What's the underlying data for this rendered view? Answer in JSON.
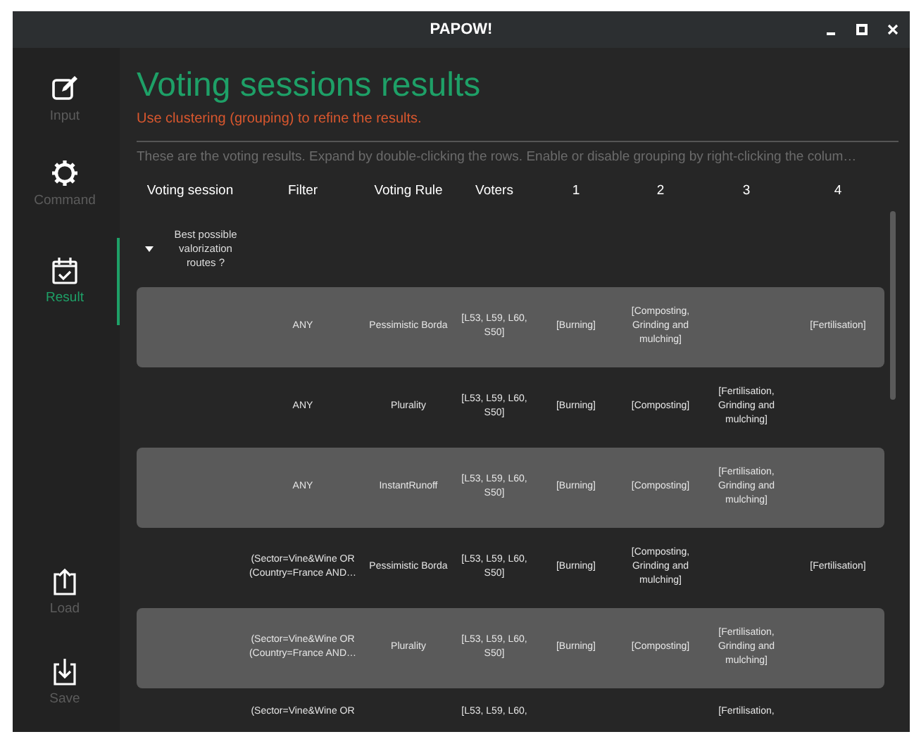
{
  "window": {
    "title": "PAPOW!"
  },
  "sidebar": {
    "items": [
      {
        "label": "Input",
        "kind": "edit",
        "selected": false
      },
      {
        "label": "Command",
        "kind": "gear",
        "selected": false
      },
      {
        "label": "Result",
        "kind": "calendar",
        "selected": true
      }
    ],
    "bottom_items": [
      {
        "label": "Load",
        "kind": "upload"
      },
      {
        "label": "Save",
        "kind": "download"
      }
    ]
  },
  "heading": "Voting sessions results",
  "subtitle": "Use clustering (grouping) to refine the results.",
  "description": "These are the voting results. Expand by double-clicking the rows. Enable or disable grouping by right-clicking the colum…",
  "table": {
    "columns": [
      "Voting session",
      "Filter",
      "Voting Rule",
      "Voters",
      "1",
      "2",
      "3",
      "4"
    ],
    "group": {
      "label": "Best possible valorization routes ?",
      "expanded": true
    },
    "rows": [
      {
        "shaded": true,
        "cells": [
          "",
          "ANY",
          "Pessimistic Borda",
          "[L53, L59, L60, S50]",
          "[Burning]",
          "[Composting, Grinding and mulching]",
          "",
          "[Fertilisation]"
        ]
      },
      {
        "shaded": false,
        "cells": [
          "",
          "ANY",
          "Plurality",
          "[L53, L59, L60, S50]",
          "[Burning]",
          "[Composting]",
          "[Fertilisation, Grinding and mulching]",
          ""
        ]
      },
      {
        "shaded": true,
        "cells": [
          "",
          "ANY",
          "InstantRunoff",
          "[L53, L59, L60, S50]",
          "[Burning]",
          "[Composting]",
          "[Fertilisation, Grinding and mulching]",
          ""
        ]
      },
      {
        "shaded": false,
        "cells": [
          "",
          "(Sector=Vine&Wine OR (Country=France AND…",
          "Pessimistic Borda",
          "[L53, L59, L60, S50]",
          "[Burning]",
          "[Composting, Grinding and mulching]",
          "",
          "[Fertilisation]"
        ]
      },
      {
        "shaded": true,
        "cells": [
          "",
          "(Sector=Vine&Wine OR (Country=France AND…",
          "Plurality",
          "[L53, L59, L60, S50]",
          "[Burning]",
          "[Composting]",
          "[Fertilisation, Grinding and mulching]",
          ""
        ]
      },
      {
        "shaded": false,
        "cells": [
          "",
          "(Sector=Vine&Wine OR",
          "",
          "[L53, L59, L60,",
          "",
          "",
          "[Fertilisation,",
          ""
        ]
      }
    ]
  }
}
